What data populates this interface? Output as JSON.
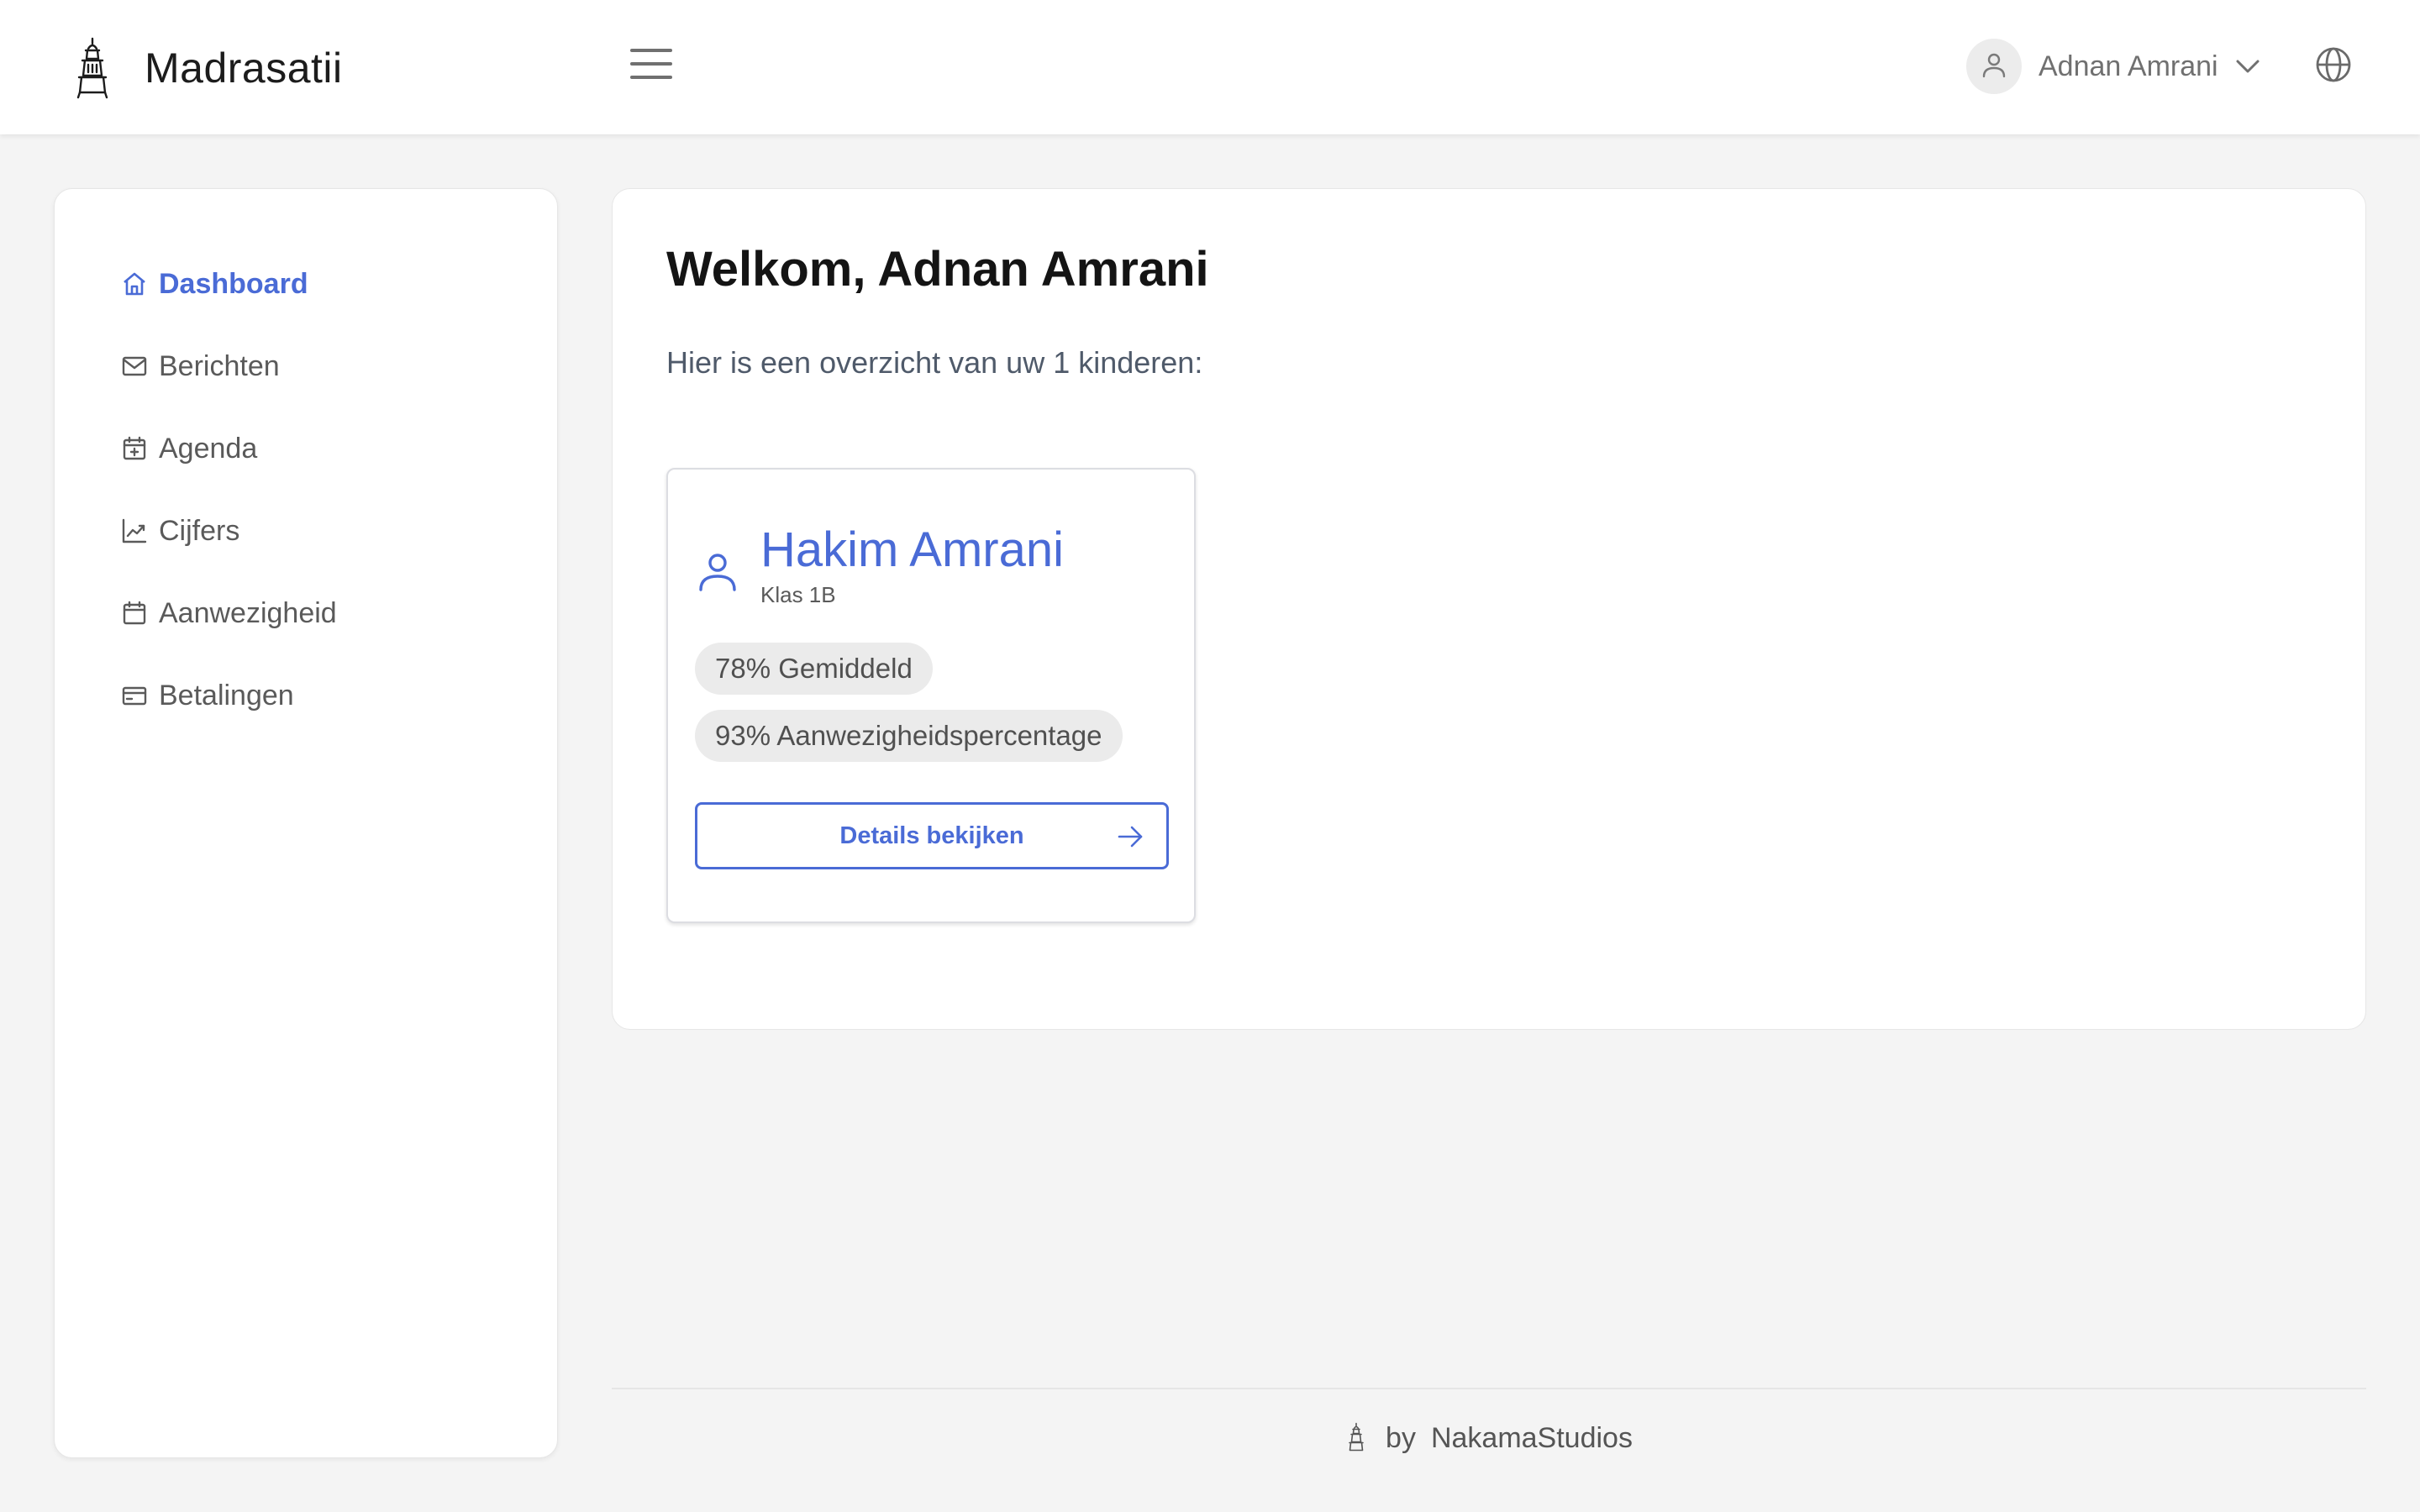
{
  "header": {
    "brand_name": "Madrasatii",
    "user_name": "Adnan Amrani"
  },
  "sidebar": {
    "items": [
      {
        "label": "Dashboard",
        "icon": "home-icon",
        "active": true
      },
      {
        "label": "Berichten",
        "icon": "mail-icon",
        "active": false
      },
      {
        "label": "Agenda",
        "icon": "calendar-plus-icon",
        "active": false
      },
      {
        "label": "Cijfers",
        "icon": "chart-line-icon",
        "active": false
      },
      {
        "label": "Aanwezigheid",
        "icon": "calendar-icon",
        "active": false
      },
      {
        "label": "Betalingen",
        "icon": "credit-card-icon",
        "active": false
      }
    ]
  },
  "main": {
    "welcome": "Welkom, Adnan Amrani",
    "overview": "Hier is een overzicht van uw 1 kinderen:",
    "children": [
      {
        "name": "Hakim Amrani",
        "class": "Klas 1B",
        "average": "78% Gemiddeld",
        "attendance": "93% Aanwezigheidspercentage",
        "details_label": "Details bekijken"
      }
    ]
  },
  "footer": {
    "by": "by",
    "studio": "NakamaStudios"
  },
  "colors": {
    "accent": "#4a6bd6",
    "background": "#f4f4f4",
    "badge": "#ebebeb"
  }
}
